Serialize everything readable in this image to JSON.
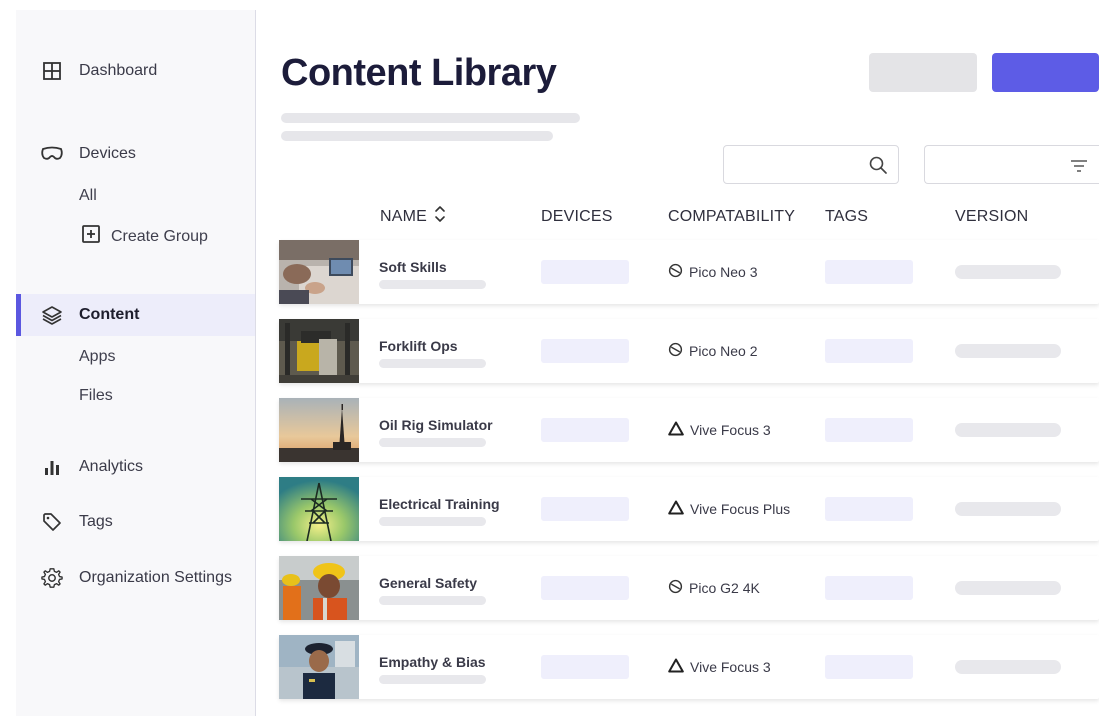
{
  "sidebar": {
    "items": [
      {
        "label": "Dashboard",
        "icon": "dashboard-grid-icon"
      },
      {
        "label": "Devices",
        "icon": "vr-headset-icon"
      },
      {
        "label": "Content",
        "icon": "layers-icon",
        "active": true
      },
      {
        "label": "Analytics",
        "icon": "bar-chart-icon"
      },
      {
        "label": "Tags",
        "icon": "tag-icon"
      },
      {
        "label": "Organization Settings",
        "icon": "gear-icon"
      }
    ],
    "devices_sub": {
      "all": "All",
      "create_group": "Create Group"
    },
    "content_sub": {
      "apps": "Apps",
      "files": "Files"
    }
  },
  "page": {
    "title": "Content Library"
  },
  "search": {
    "placeholder": ""
  },
  "table": {
    "columns": {
      "name": "NAME",
      "devices": "DEVICES",
      "compatability": "COMPATABILITY",
      "tags": "TAGS",
      "version": "VERSION"
    },
    "rows": [
      {
        "name": "Soft Skills",
        "compat": "Pico Neo 3",
        "compat_icon": "pico-icon",
        "thumb": "office-meeting"
      },
      {
        "name": "Forklift Ops",
        "compat": "Pico Neo 2",
        "compat_icon": "pico-icon",
        "thumb": "forklift"
      },
      {
        "name": "Oil Rig Simulator",
        "compat": "Vive Focus 3",
        "compat_icon": "vive-icon",
        "thumb": "oil-rig"
      },
      {
        "name": "Electrical Training",
        "compat": "Vive Focus Plus",
        "compat_icon": "vive-icon",
        "thumb": "power-tower"
      },
      {
        "name": "General Safety",
        "compat": "Pico G2 4K",
        "compat_icon": "pico-icon",
        "thumb": "safety-workers"
      },
      {
        "name": "Empathy & Bias",
        "compat": "Vive Focus 3",
        "compat_icon": "vive-icon",
        "thumb": "police-officer"
      }
    ]
  },
  "colors": {
    "accent": "#5d5ce6",
    "sidebar_bg": "#f8f8fa",
    "active_bg": "#ededfa",
    "skeleton": "#e6e6ea"
  }
}
